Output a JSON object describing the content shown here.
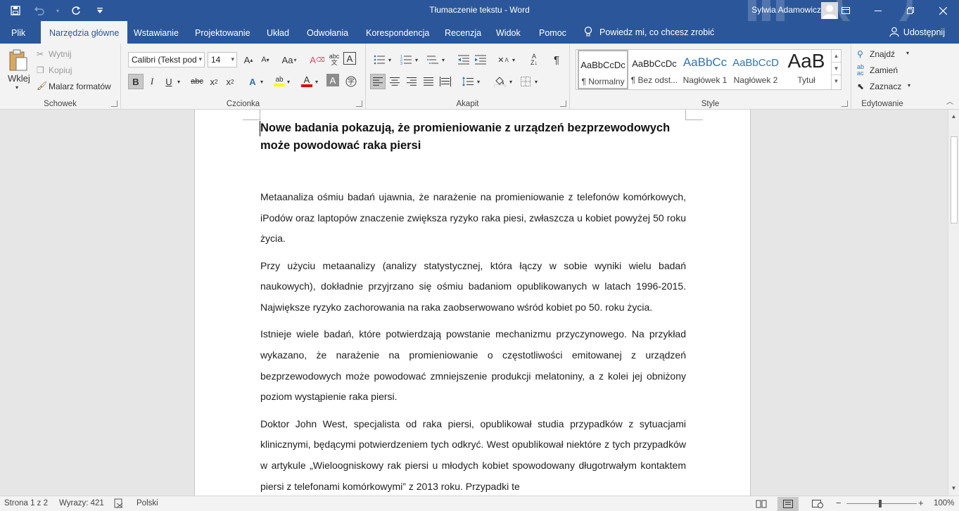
{
  "titlebar": {
    "title": "Tłumaczenie tekstu  -  Word",
    "user": "Sylwia Adamowicz",
    "qat_icons": [
      "save-icon",
      "undo-icon",
      "redo-icon",
      "customize-qat-icon"
    ],
    "window_icons": [
      "ribbon-display-options-icon",
      "minimize-icon",
      "restore-icon",
      "close-icon"
    ],
    "bg": "#2b579a"
  },
  "tabs": {
    "items": [
      "Plik",
      "Narzędzia główne",
      "Wstawianie",
      "Projektowanie",
      "Układ",
      "Odwołania",
      "Korespondencja",
      "Recenzja",
      "Widok",
      "Pomoc"
    ],
    "active": "Narzędzia główne",
    "tell_me": "Powiedz mi, co chcesz zrobić",
    "share": "Udostępnij"
  },
  "ribbon": {
    "clipboard": {
      "label": "Schowek",
      "paste": "Wklej",
      "cut": "Wytnij",
      "copy": "Kopiuj",
      "format_painter": "Malarz formatów"
    },
    "font": {
      "label": "Czcionka",
      "font_name": "Calibri (Tekst pod",
      "font_size": "14",
      "change_case": "Aa"
    },
    "paragraph": {
      "label": "Akapit"
    },
    "styles": {
      "label": "Style",
      "items": [
        {
          "preview": "AaBbCcDc",
          "name": "¶ Normalny"
        },
        {
          "preview": "AaBbCcDc",
          "name": "¶ Bez odst..."
        },
        {
          "preview": "AaBbCc",
          "name": "Nagłówek 1"
        },
        {
          "preview": "AaBbCcD",
          "name": "Nagłówek 2"
        },
        {
          "preview": "AaB",
          "name": "Tytuł"
        }
      ]
    },
    "editing": {
      "label": "Edytowanie",
      "find": "Znajdź",
      "replace": "Zamień",
      "select": "Zaznacz"
    }
  },
  "document": {
    "title": "Nowe badania pokazują, że promieniowanie z urządzeń bezprzewodowych może powodować raka piersi",
    "paragraphs": [
      "Metaanaliza ośmiu badań ujawnia, że narażenie na promieniowanie z telefonów komórkowych, iPodów oraz laptopów znaczenie zwiększa ryzyko raka piesi, zwłaszcza u kobiet powyżej 50 roku życia.",
      "Przy użyciu metaanalizy (analizy statystycznej, która łączy w sobie wyniki wielu badań naukowych), dokładnie przyjrzano się ośmiu badaniom opublikowanych w latach 1996-2015. Największe ryzyko zachorowania na raka zaobserwowano wśród kobiet po 50. roku życia.",
      "Istnieje wiele badań, które potwierdzają powstanie mechanizmu przyczynowego. Na przykład wykazano, że narażenie na promieniowanie o częstotliwości emitowanej z urządzeń bezprzewodowych może powodować zmniejszenie produkcji melatoniny, a z kolei jej obniżony poziom wystąpienie raka piersi.",
      "Doktor John West, specjalista od raka piersi, opublikował studia przypadków z sytuacjami klinicznymi, będącymi potwierdzeniem tych odkryć. West opublikował niektóre z tych przypadków w artykule „Wieloogniskowy rak piersi u młodych kobiet spowodowany długotrwałym kontaktem piersi z telefonami komórkowymi” z 2013 roku. Przypadki te"
    ]
  },
  "statusbar": {
    "page": "Strona 1 z 2",
    "words": "Wyrazy: 421",
    "language": "Polski",
    "zoom": "100%",
    "zoom_level_percent": 100
  }
}
